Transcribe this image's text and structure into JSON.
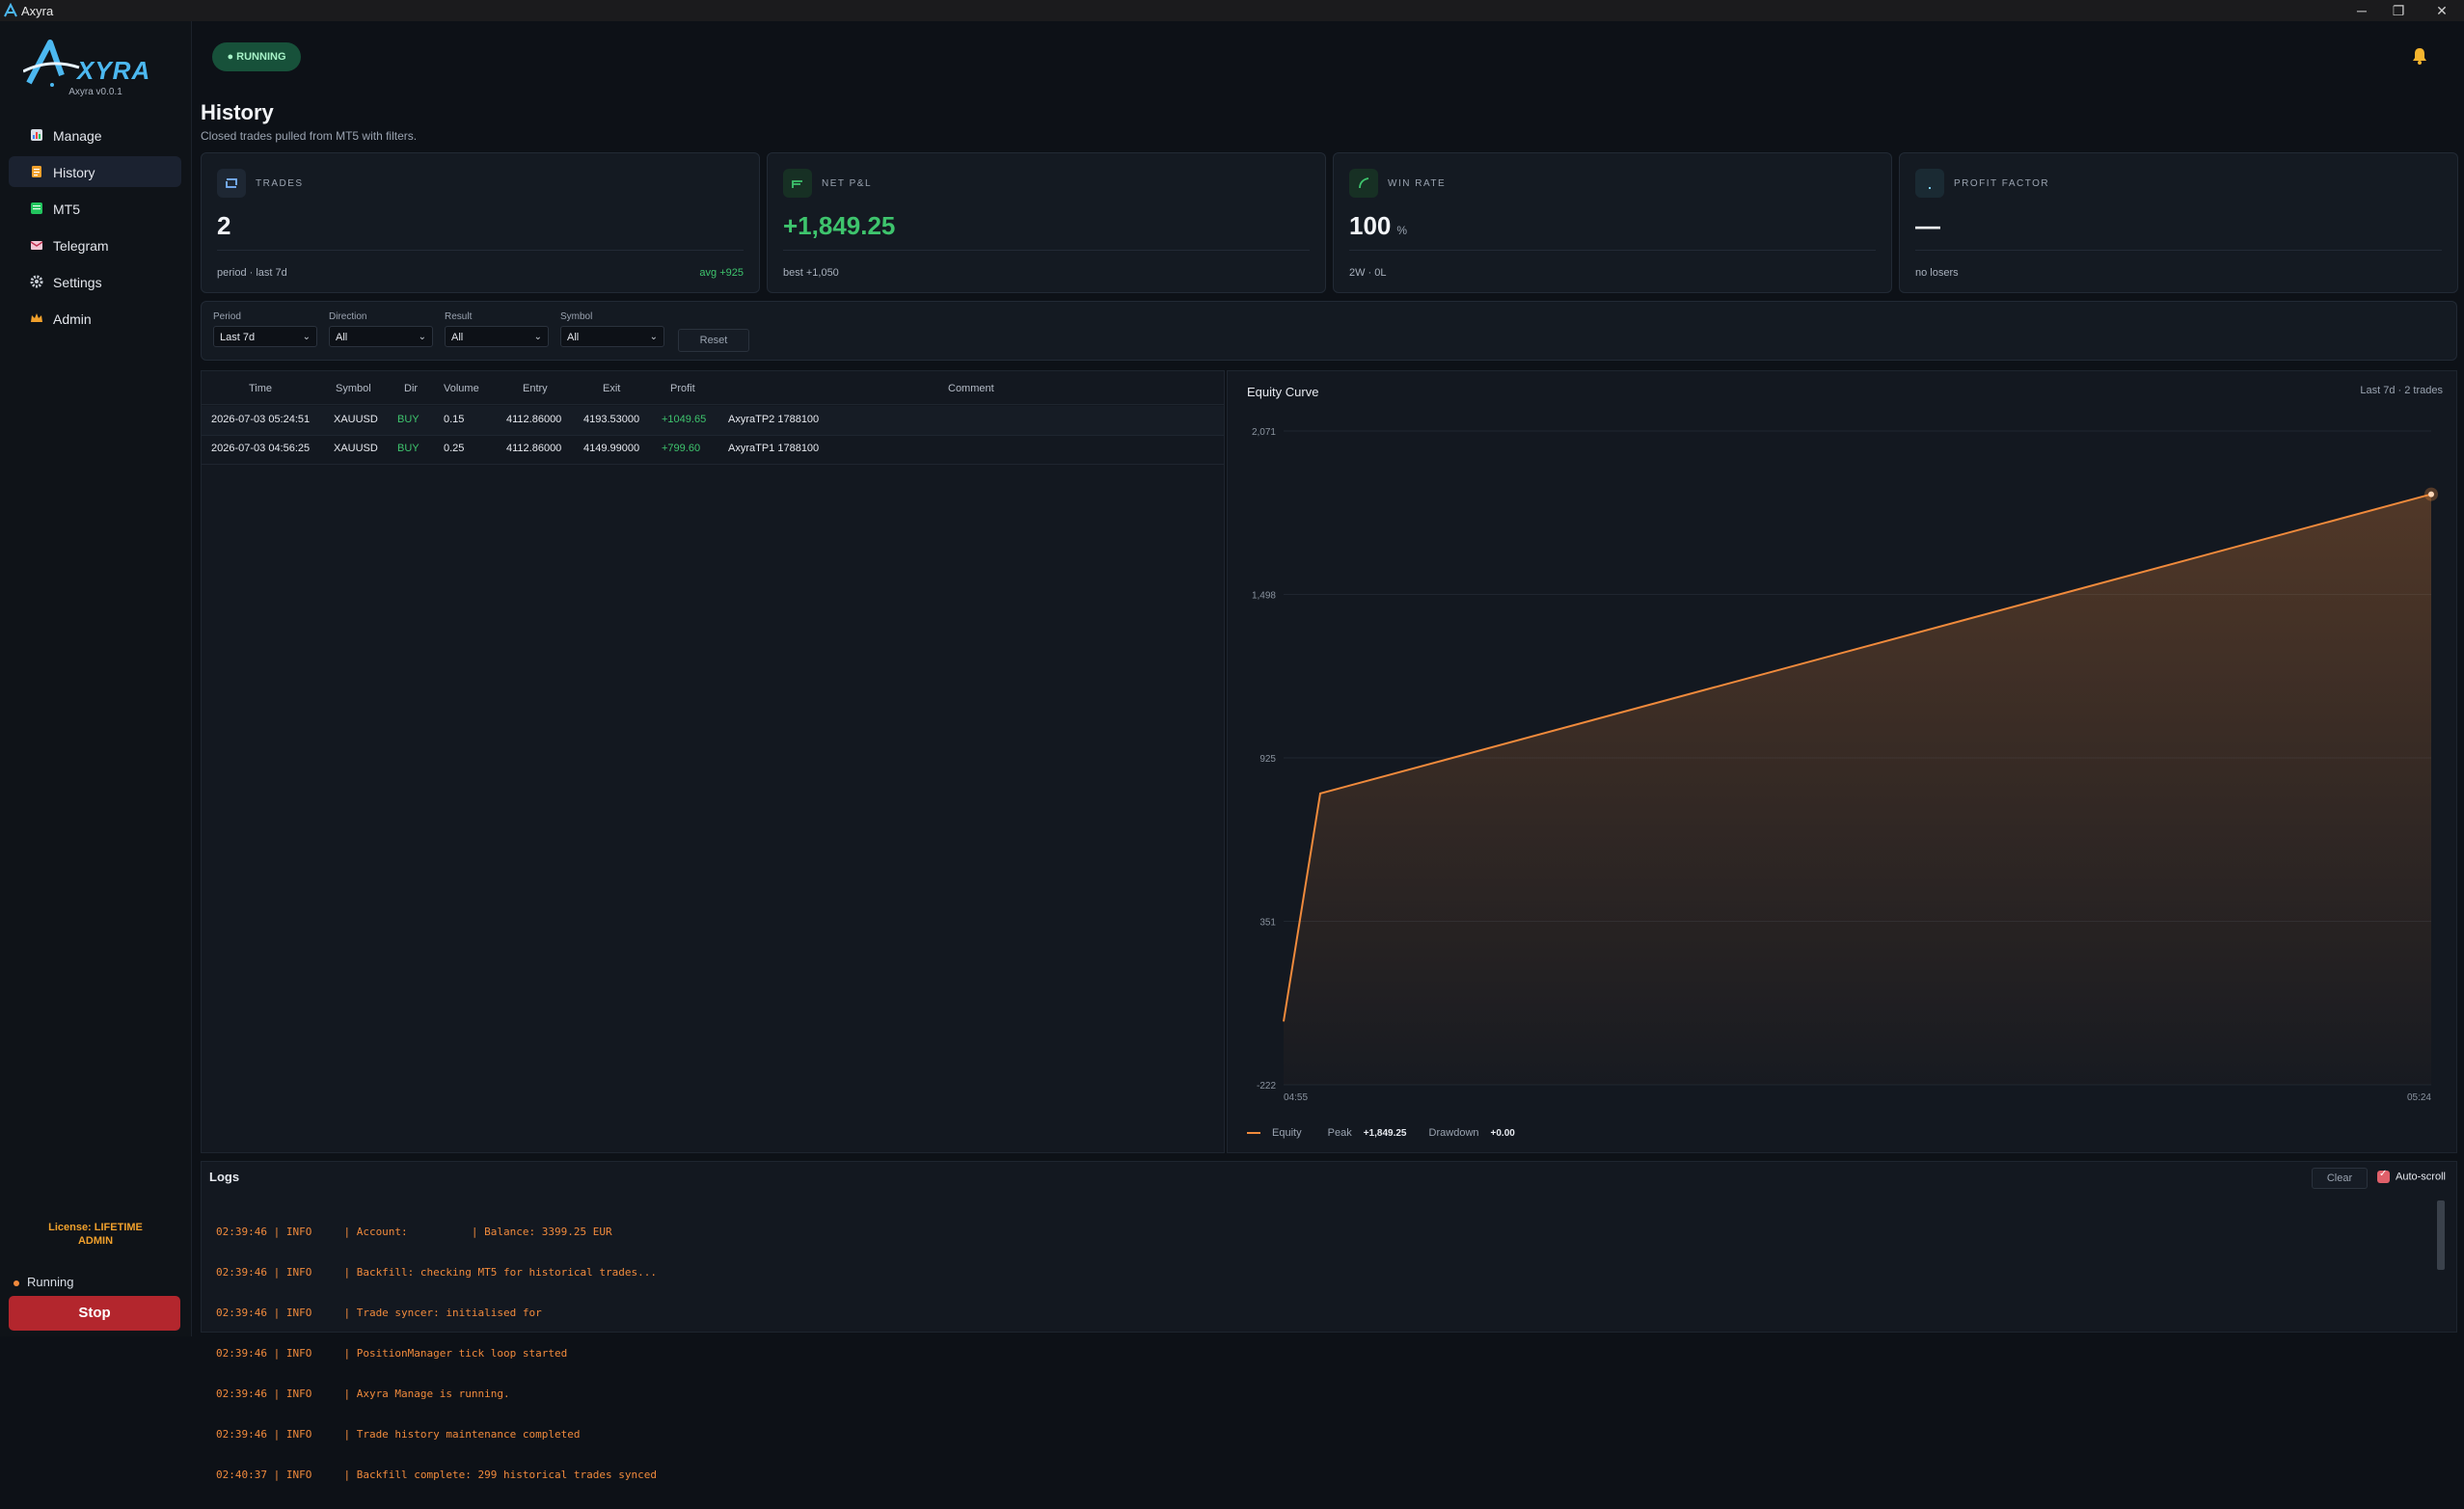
{
  "window": {
    "title": "Axyra"
  },
  "sidebar": {
    "logo_text": "XYRA",
    "version": "Axyra v0.0.1",
    "items": [
      {
        "label": "Manage",
        "icon": "chart-bar-icon",
        "active": false
      },
      {
        "label": "History",
        "icon": "clipboard-icon",
        "active": true
      },
      {
        "label": "MT5",
        "icon": "green-square-icon",
        "active": false
      },
      {
        "label": "Telegram",
        "icon": "mail-icon",
        "active": false
      },
      {
        "label": "Settings",
        "icon": "gear-icon",
        "active": false
      },
      {
        "label": "Admin",
        "icon": "crown-icon",
        "active": false
      }
    ],
    "license_line1": "License: LIFETIME",
    "license_line2": "ADMIN",
    "run_status": "Running",
    "stop_label": "Stop"
  },
  "header": {
    "status_badge": "● RUNNING",
    "page_title": "History",
    "page_subtitle": "Closed trades pulled from MT5 with filters."
  },
  "stats": [
    {
      "label": "TRADES",
      "value": "2",
      "unit": "",
      "footer": "period · last 7d",
      "footer_right": "avg +925",
      "value_color": "#f2f4f7"
    },
    {
      "label": "NET P&L",
      "value": "+1,849.25",
      "unit": "",
      "footer": "best +1,050",
      "footer_right": "",
      "value_color": "#3ec46d"
    },
    {
      "label": "WIN RATE",
      "value": "100",
      "unit": "%",
      "footer": "2W · 0L",
      "footer_right": "",
      "value_color": "#f2f4f7"
    },
    {
      "label": "PROFIT FACTOR",
      "value": "—",
      "unit": "",
      "footer": "no losers",
      "footer_right": "",
      "value_color": "#f2f4f7"
    }
  ],
  "filters": {
    "period": {
      "label": "Period",
      "value": "Last 7d"
    },
    "direction": {
      "label": "Direction",
      "value": "All"
    },
    "result": {
      "label": "Result",
      "value": "All"
    },
    "symbol": {
      "label": "Symbol",
      "value": "All"
    },
    "reset_label": "Reset"
  },
  "trades": {
    "columns": [
      "Time",
      "Symbol",
      "Dir",
      "Volume",
      "Entry",
      "Exit",
      "Profit",
      "Comment"
    ],
    "rows": [
      [
        "2026-07-03 05:24:51",
        "XAUUSD",
        "BUY",
        "0.15",
        "4112.86000",
        "4193.53000",
        "+1049.65",
        "AxyraTP2 1788100"
      ],
      [
        "2026-07-03 04:56:25",
        "XAUUSD",
        "BUY",
        "0.25",
        "4112.86000",
        "4149.99000",
        "+799.60",
        "AxyraTP1 1788100"
      ]
    ]
  },
  "equity": {
    "title": "Equity Curve",
    "meta": "Last 7d · 2 trades",
    "legend_equity": "Equity",
    "legend_peak_label": "Peak",
    "legend_peak_value": "+1,849.25",
    "legend_drawdown_label": "Drawdown",
    "legend_drawdown_value": "+0.00"
  },
  "chart_data": {
    "type": "area",
    "title": "Equity Curve",
    "x": [
      "start",
      "04:56",
      "05:24"
    ],
    "x_tick_labels": [
      "04:55",
      "05:24"
    ],
    "series": [
      {
        "name": "Equity",
        "values": [
          0,
          799.6,
          1849.25
        ],
        "color": "#f08a3c"
      }
    ],
    "y_ticks": [
      "2,071",
      "1,498",
      "925",
      "351",
      "-222"
    ],
    "ylim": [
      -222,
      2071
    ],
    "grid": true,
    "legend": "bottom-left"
  },
  "logs": {
    "title": "Logs",
    "clear_label": "Clear",
    "autoscroll_label": "Auto-scroll",
    "lines": [
      "02:39:46 | INFO     | Account:          | Balance: 3399.25 EUR",
      "02:39:46 | INFO     | Backfill: checking MT5 for historical trades...",
      "02:39:46 | INFO     | Trade syncer: initialised for",
      "02:39:46 | INFO     | PositionManager tick loop started",
      "02:39:46 | INFO     | Axyra Manage is running.",
      "02:39:46 | INFO     | Trade history maintenance completed",
      "02:40:37 | INFO     | Backfill complete: 299 historical trades synced"
    ]
  },
  "colors": {
    "accent": "#f08a3c",
    "positive": "#3ec46d",
    "stop": "#b3262d",
    "running_badge": "#17513a",
    "license": "#f0a02c"
  }
}
